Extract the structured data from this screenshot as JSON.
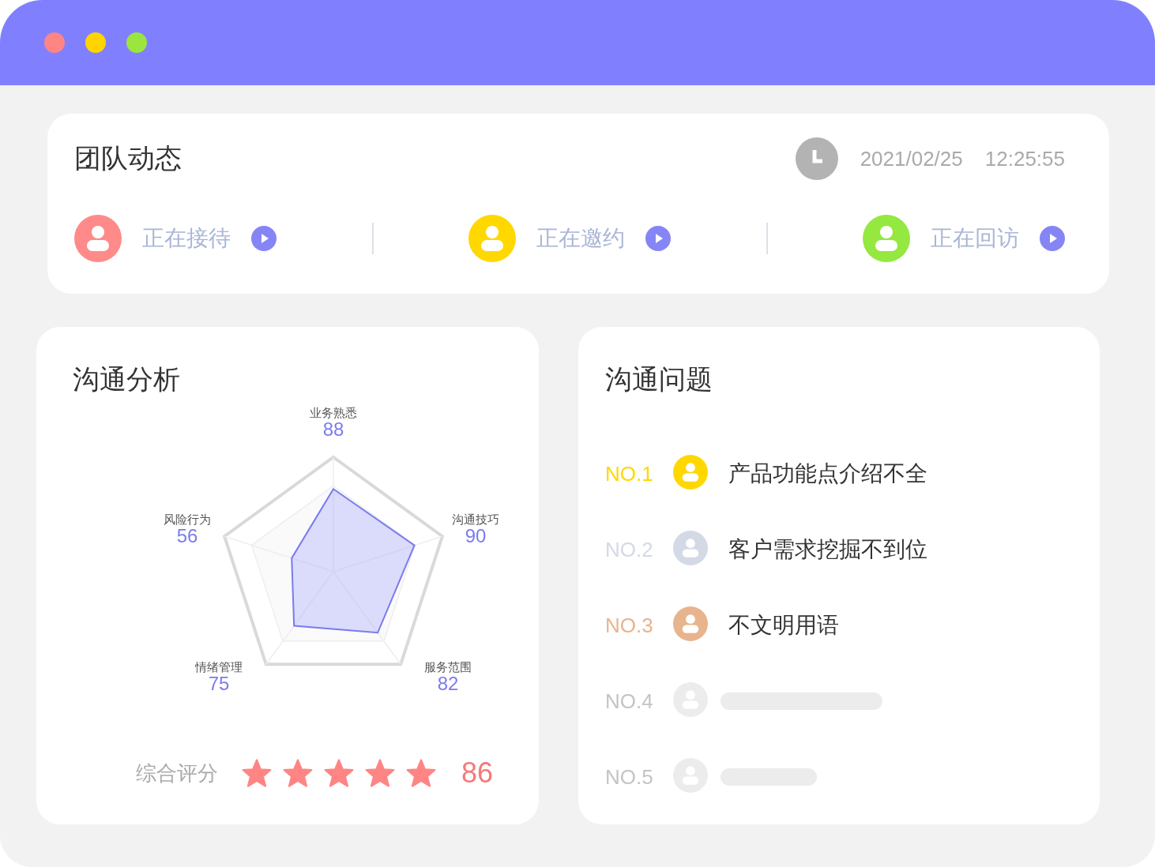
{
  "window": {
    "dots": [
      {
        "color": "#ff8585"
      },
      {
        "color": "#ffd400"
      },
      {
        "color": "#9be53f"
      }
    ]
  },
  "team": {
    "title": "团队动态",
    "date": "2021/02/25",
    "time": "12:25:55",
    "statuses": [
      {
        "label": "正在接待",
        "color": "#ff8a8a"
      },
      {
        "label": "正在邀约",
        "color": "#ffd800"
      },
      {
        "label": "正在回访",
        "color": "#95e83f"
      }
    ]
  },
  "analysis": {
    "title": "沟通分析",
    "axes": [
      {
        "label": "业务熟悉",
        "value": "88"
      },
      {
        "label": "风险行为",
        "value": "56"
      },
      {
        "label": "沟通技巧",
        "value": "90"
      },
      {
        "label": "情绪管理",
        "value": "75"
      },
      {
        "label": "服务范围",
        "value": "82"
      }
    ],
    "score_label": "综合评分",
    "stars": 5,
    "score": "86"
  },
  "issues": {
    "title": "沟通问题",
    "rows": [
      {
        "kind": "item",
        "rank": "NO.1",
        "color": "#ffd800",
        "text": "产品功能点介绍不全"
      },
      {
        "kind": "item",
        "rank": "NO.2",
        "color": "#d4d9e6",
        "text": "客户需求挖掘不到位"
      },
      {
        "kind": "item",
        "rank": "NO.3",
        "color": "#e8b48d",
        "text": "不文明用语"
      },
      {
        "kind": "skeleton",
        "rank": "NO.4",
        "color": "#ececec"
      },
      {
        "kind": "skeleton",
        "rank": "NO.5",
        "color": "#ececec"
      }
    ]
  }
}
